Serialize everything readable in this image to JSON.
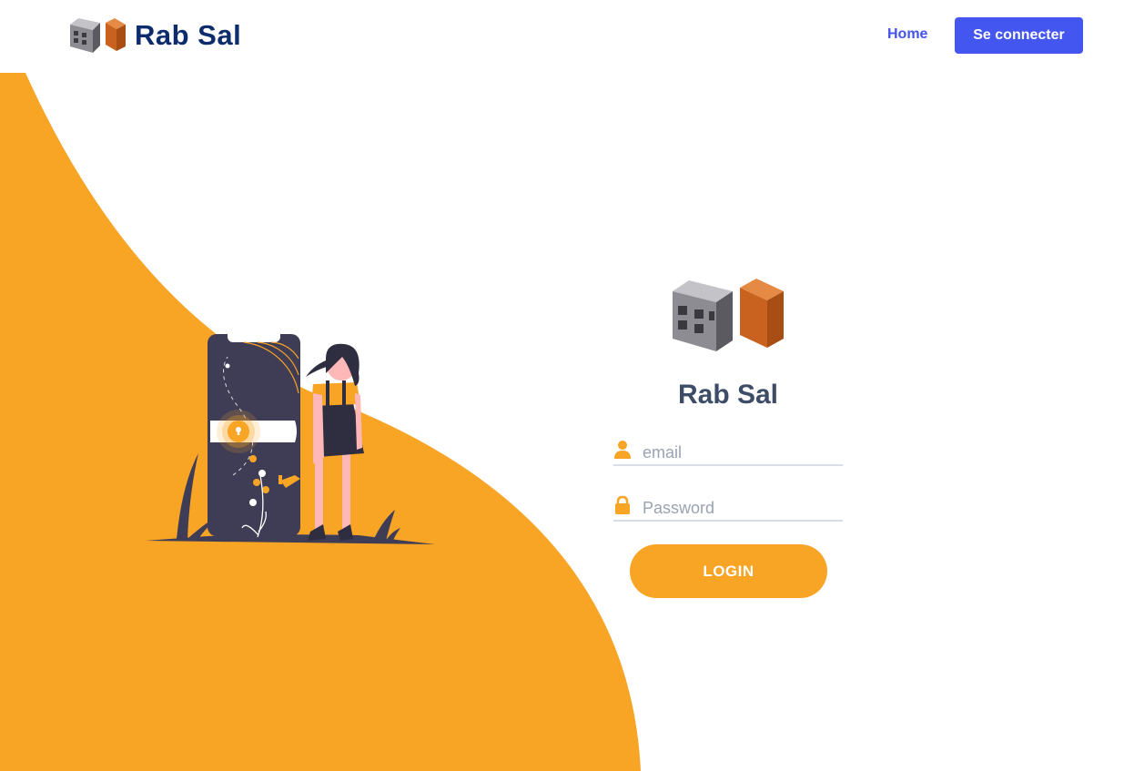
{
  "navbar": {
    "brand_name": "Rab Sal",
    "links": {
      "home": "Home",
      "login_button": "Se connecter"
    }
  },
  "login": {
    "title": "Rab Sal",
    "email_placeholder": "email",
    "password_placeholder": "Password",
    "submit_label": "LOGIN"
  },
  "icons": {
    "brand_logo": "concrete-block-and-brick-icon",
    "email_field": "user-icon",
    "password_field": "lock-icon"
  },
  "colors": {
    "accent_orange": "#f8a425",
    "brand_navy": "#0d2c6e",
    "nav_blue": "#4456f0",
    "title_slate": "#3e4d67",
    "illustration_dark": "#3f3d56"
  }
}
